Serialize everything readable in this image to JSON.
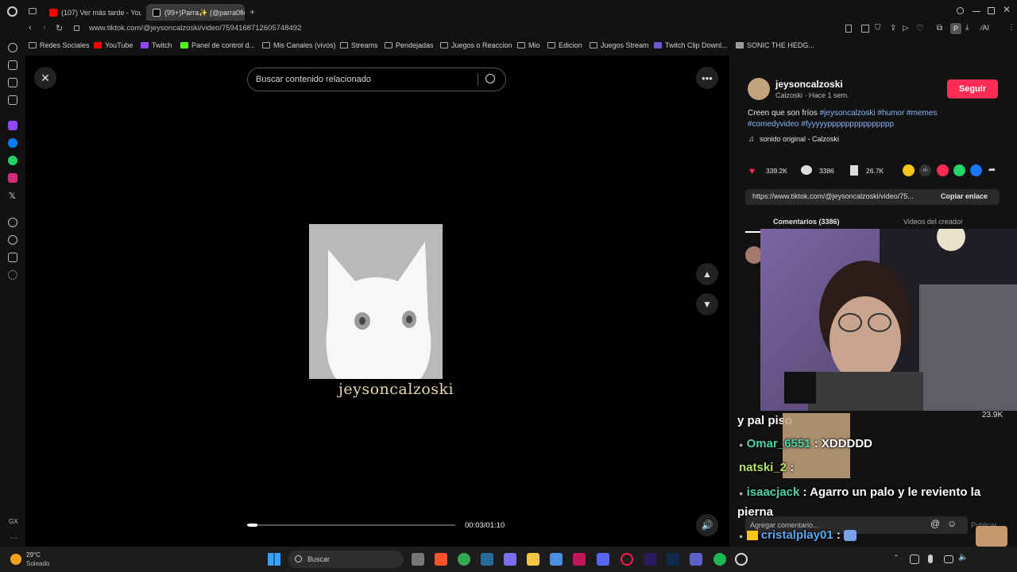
{
  "tabs": [
    {
      "title": "(107) Ver más tarde - YouT"
    },
    {
      "title": "(99+)Parra✨ (@parra0fic"
    }
  ],
  "address": {
    "url": "www.tiktok.com/@jeysoncalzoski/video/7594168712605748492"
  },
  "bookmarks": [
    "Redes Sociales",
    "YouTube",
    "Twitch",
    "Panel de control d...",
    "Mis Canales (vivos)",
    "Streams",
    "Pendejadas",
    "Juegos o Reaccion",
    "Mio",
    "Edicion",
    "Juegos Stream",
    "Twitch Clip Downl...",
    "SONIC THE HEDG..."
  ],
  "search": {
    "placeholder": "Buscar contenido relacionado"
  },
  "video": {
    "watermark": "jeysoncalzoski",
    "time": "00:03/01:10",
    "progress": 0.043
  },
  "author": {
    "name": "jeysoncalzoski",
    "sub": "Calzoski · Hace 1 sem.",
    "follow_label": "Seguir"
  },
  "caption": {
    "text": "Creen que son fríos",
    "tags1": "#jeysoncalzoski #humor #memes",
    "tags2": "#comedyvideo #fyyyyyppppppppppppppp",
    "sound": "sonido original - Calzoski"
  },
  "stats": {
    "likes": "339.2K",
    "comments": "3386",
    "saves": "26.7K"
  },
  "link": {
    "url": "https://www.tiktok.com/@jeysoncalzoski/video/75...",
    "copy_label": "Copiar enlace"
  },
  "panel_tabs": {
    "comments": "Comentarios (3386)",
    "creator": "Videos del creador"
  },
  "stream": {
    "viewers": "23.9K"
  },
  "chat": [
    {
      "user": "",
      "msg": "y pal piso",
      "color": "#ffffff"
    },
    {
      "user": "Omar_6551",
      "msg": ": XDDDDD",
      "color": "#4fd6a8"
    },
    {
      "user": "natski_2",
      "msg": ":",
      "color": "#b5e36b"
    },
    {
      "user": "isaacjack",
      "msg": ": Agarro un palo y le reviento la",
      "color": "#4fd6a8"
    },
    {
      "user": "",
      "msg": "pierna",
      "color": "#ffffff"
    },
    {
      "user": "cristalplay01",
      "msg": ":",
      "color": "#5aa9f0"
    }
  ],
  "comment_input": {
    "placeholder": "Agregar comentario...",
    "publish": "Publicar"
  },
  "taskbar": {
    "weather_temp": "29°C",
    "weather_desc": "Soleado",
    "search": "Buscar",
    "gx": "GX"
  }
}
